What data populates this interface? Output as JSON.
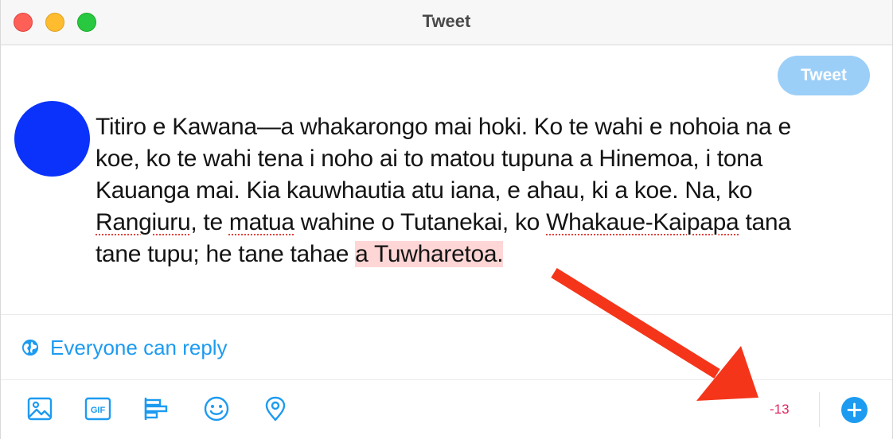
{
  "window": {
    "title": "Tweet"
  },
  "compose": {
    "tweet_button_label": "Tweet",
    "lines": [
      [
        {
          "text": "Titiro e Kawana—a whakarongo mai hoki. Ko te wahi e nohoia na e",
          "style": "normal"
        }
      ],
      [
        {
          "text": "koe, ko te wahi tena i noho ai to matou tupuna a Hinemoa, i tona",
          "style": "normal"
        }
      ],
      [
        {
          "text": "Kauanga mai. Kia kauwhautia atu iana, e ahau, ki a koe. Na, ko",
          "style": "normal"
        }
      ],
      [
        {
          "text": "Rangiuru",
          "style": "spell"
        },
        {
          "text": ", te ",
          "style": "normal"
        },
        {
          "text": "matua",
          "style": "spell"
        },
        {
          "text": " wahine o Tutanekai, ko ",
          "style": "normal"
        },
        {
          "text": "Whakaue-Kaipapa",
          "style": "spell"
        },
        {
          "text": " tana",
          "style": "normal"
        }
      ],
      [
        {
          "text": "tane tupu; he tane tahae ",
          "style": "normal"
        },
        {
          "text": "a Tuwharetoa.",
          "style": "overflow"
        }
      ]
    ]
  },
  "reply_setting": {
    "label": "Everyone can reply",
    "icon": "globe-icon"
  },
  "toolbar": {
    "icons": [
      "image-icon",
      "gif-icon",
      "poll-icon",
      "emoji-icon",
      "location-icon"
    ],
    "gif_label": "GIF",
    "char_count": "-13",
    "add_icon": "plus-icon"
  },
  "colors": {
    "accent": "#1d9bf0",
    "tweet_button_disabled": "#9ccff8",
    "avatar": "#0a32fa",
    "overflow_highlight": "#ffd6d6",
    "over_limit_count": "#e0245e",
    "annotation_arrow": "#f5351a"
  }
}
